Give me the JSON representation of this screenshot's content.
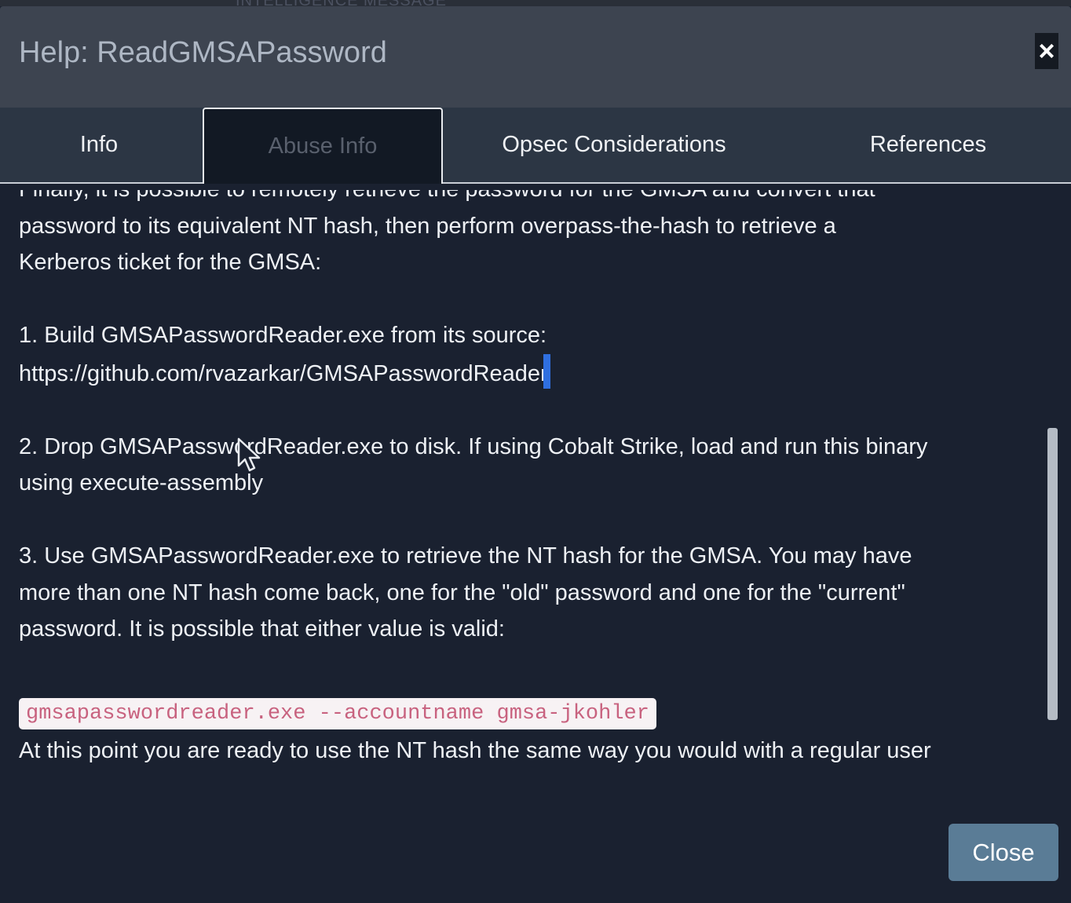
{
  "backdrop": {
    "text": "INTELLIGENCE MESSAGE"
  },
  "dialog": {
    "title": "Help: ReadGMSAPassword",
    "close_icon": "close-x-icon",
    "footer_close_label": "Close"
  },
  "tabs": [
    {
      "label": "Info",
      "active": false
    },
    {
      "label": "Abuse Info",
      "active": true
    },
    {
      "label": "Opsec Considerations",
      "active": false
    },
    {
      "label": "References",
      "active": false
    }
  ],
  "content": {
    "clipped_top_line": "Finally, it is possible to remotely retrieve the password for the GMSA and convert that",
    "intro_line_1": "password to its equivalent NT hash, then perform overpass-the-hash to retrieve a",
    "intro_line_2": "Kerberos ticket for the GMSA:",
    "step1_line_1": "1. Build GMSAPasswordReader.exe from its source:",
    "step1_link": "https://github.com/rvazarkar/GMSAPasswordReader",
    "step2_line_1": "2. Drop GMSAPasswordReader.exe to disk. If using Cobalt Strike, load and run this binary",
    "step2_line_2": "using execute-assembly",
    "step3_line_1": "3. Use GMSAPasswordReader.exe to retrieve the NT hash for the GMSA. You may have",
    "step3_line_2": "more than one NT hash come back, one for the \"old\" password and one for the \"current\"",
    "step3_line_3": "password. It is possible that either value is valid:",
    "code_command": "gmsapasswordreader.exe --accountname gmsa-jkohler",
    "clipped_bottom_line": "At this point you are ready to use the NT hash the same way you would with a regular user"
  },
  "colors": {
    "accent_selection": "#2f6fe0",
    "code_text": "#c8627f",
    "footer_button": "#5a7c96"
  }
}
